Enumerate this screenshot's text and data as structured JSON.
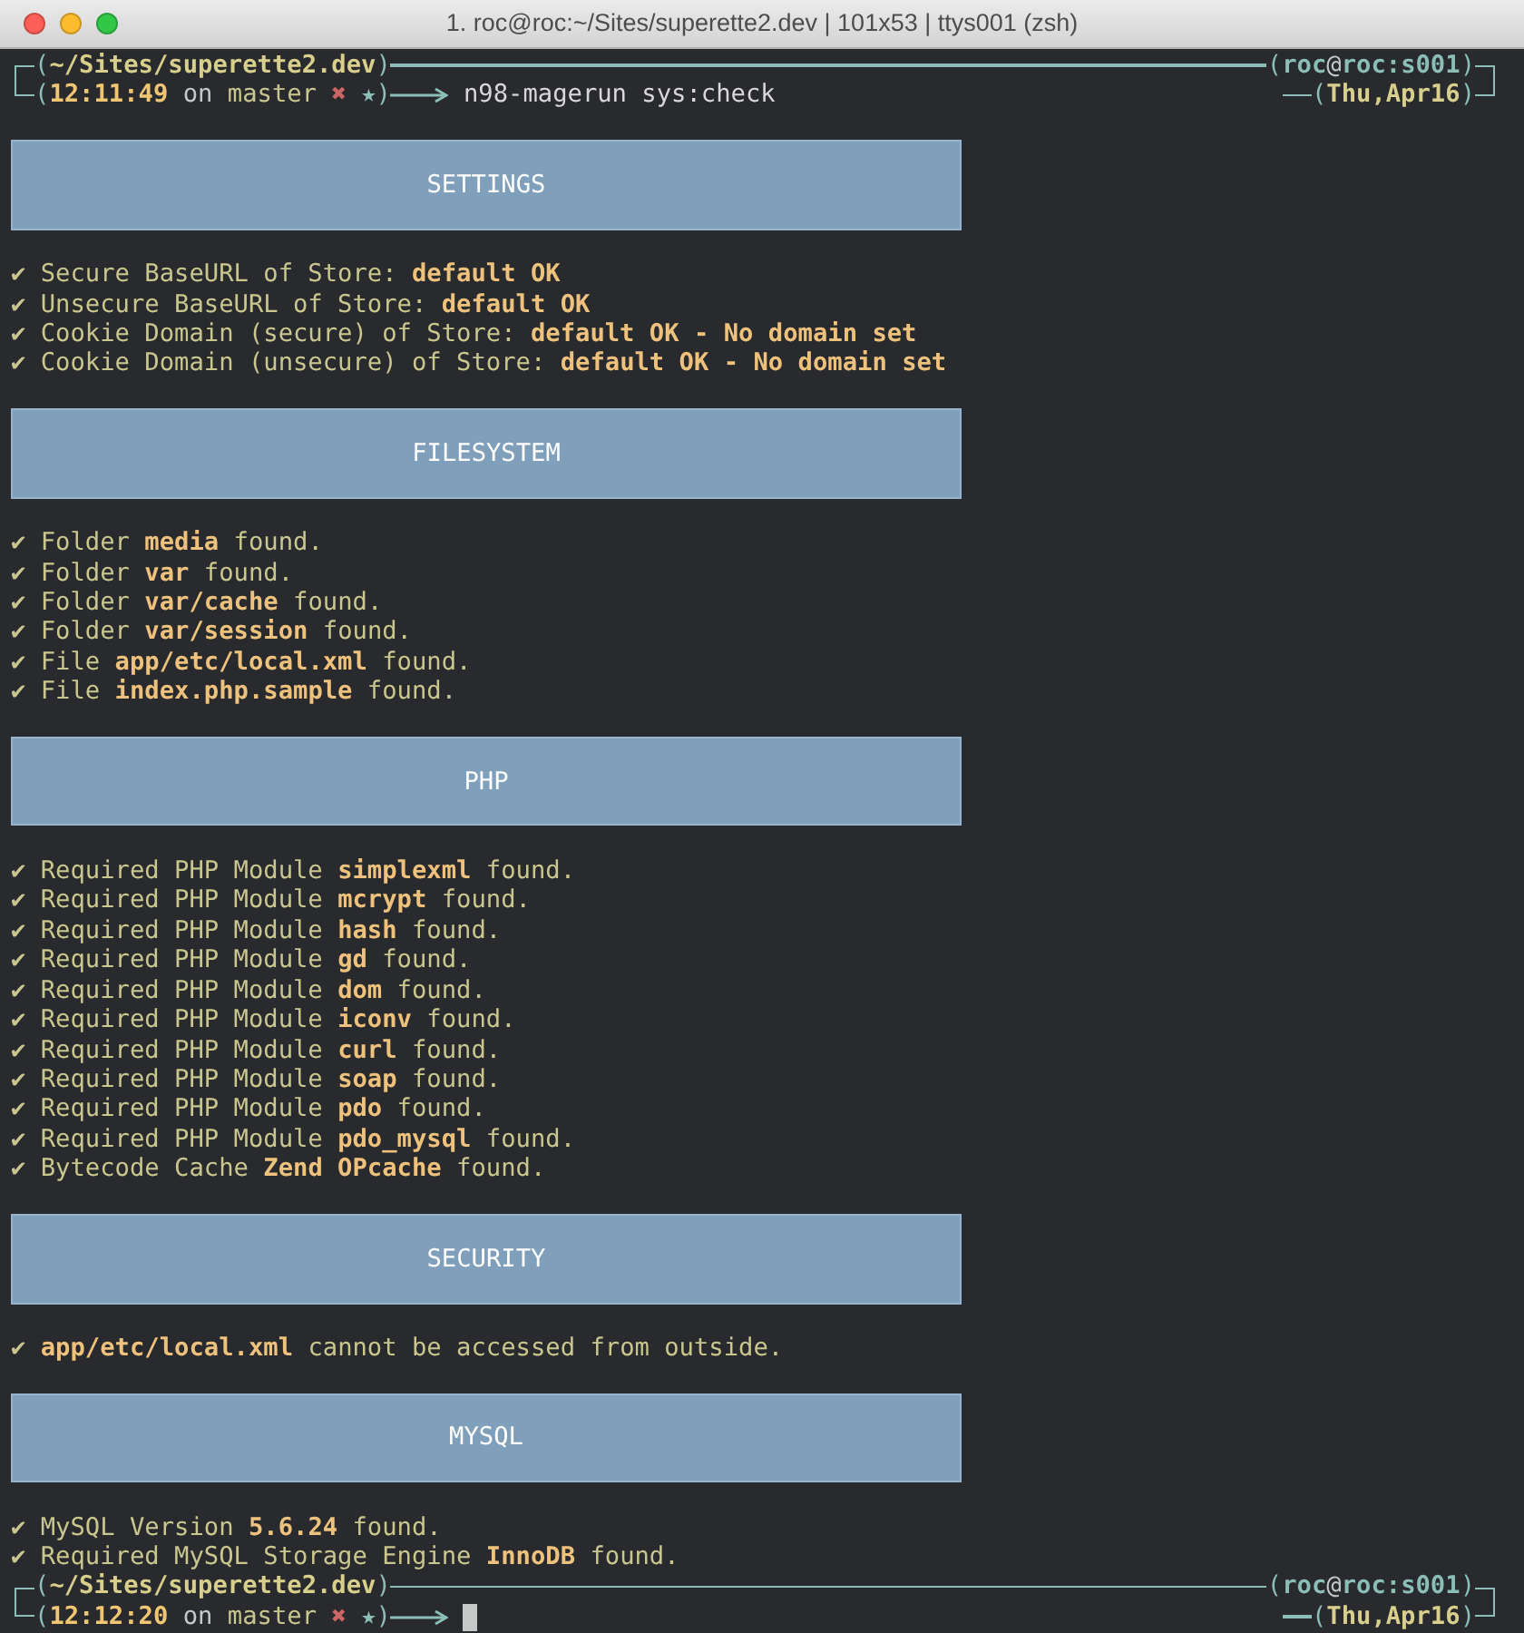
{
  "window": {
    "title": "1. roc@roc:~/Sites/superette2.dev | 101x53 | ttys001 (zsh)"
  },
  "first_prompt": {
    "line1_left": [
      {
        "kind": "paren",
        "text": "("
      },
      {
        "kind": "path",
        "text": "~/Sites/superette2.dev"
      },
      {
        "kind": "paren",
        "text": ")"
      }
    ],
    "line1_right": [
      {
        "kind": "paren",
        "text": "("
      },
      {
        "kind": "user",
        "text": "roc"
      },
      {
        "kind": "at",
        "text": "@"
      },
      {
        "kind": "user",
        "text": "roc:s001"
      },
      {
        "kind": "paren",
        "text": ")"
      }
    ],
    "line2_left": [
      {
        "kind": "paren",
        "text": "("
      },
      {
        "kind": "time",
        "text": "12:11:49"
      },
      {
        "kind": "plain",
        "text": " on "
      },
      {
        "kind": "branch",
        "text": "master"
      },
      {
        "kind": "dirty",
        "text": " ✖"
      },
      {
        "kind": "star",
        "text": " ★"
      },
      {
        "kind": "paren",
        "text": ")"
      }
    ],
    "command": "n98-magerun sys:check",
    "line2_right": [
      {
        "kind": "paren",
        "text": "("
      },
      {
        "kind": "date",
        "text": "Thu,Apr16"
      },
      {
        "kind": "paren",
        "text": ")"
      }
    ],
    "cursor": false
  },
  "sections": [
    {
      "title": "SETTINGS",
      "lines": [
        "✔ Secure BaseURL of Store: **default OK**",
        "✔ Unsecure BaseURL of Store: **default OK**",
        "✔ Cookie Domain (secure) of Store: **default OK - No domain set**",
        "✔ Cookie Domain (unsecure) of Store: **default OK - No domain set**"
      ]
    },
    {
      "title": "FILESYSTEM",
      "lines": [
        "✔ Folder **media** found.",
        "✔ Folder **var** found.",
        "✔ Folder **var/cache** found.",
        "✔ Folder **var/session** found.",
        "✔ File **app/etc/local.xml** found.",
        "✔ File **index.php.sample** found."
      ]
    },
    {
      "title": "PHP",
      "lines": [
        "✔ Required PHP Module **simplexml** found.",
        "✔ Required PHP Module **mcrypt** found.",
        "✔ Required PHP Module **hash** found.",
        "✔ Required PHP Module **gd** found.",
        "✔ Required PHP Module **dom** found.",
        "✔ Required PHP Module **iconv** found.",
        "✔ Required PHP Module **curl** found.",
        "✔ Required PHP Module **soap** found.",
        "✔ Required PHP Module **pdo** found.",
        "✔ Required PHP Module **pdo_mysql** found.",
        "✔ Bytecode Cache **Zend OPcache** found."
      ]
    },
    {
      "title": "SECURITY",
      "lines": [
        "✔ **app/etc/local.xml** cannot be accessed from outside."
      ]
    },
    {
      "title": "MYSQL",
      "lines": [
        "✔ MySQL Version **5.6.24** found.",
        "✔ Required MySQL Storage Engine **InnoDB** found."
      ]
    }
  ],
  "final_prompt": {
    "line1_left": [
      {
        "kind": "paren",
        "text": "("
      },
      {
        "kind": "path",
        "text": "~/Sites/superette2.dev"
      },
      {
        "kind": "paren",
        "text": ")"
      }
    ],
    "line1_right": [
      {
        "kind": "paren",
        "text": "("
      },
      {
        "kind": "user",
        "text": "roc"
      },
      {
        "kind": "at",
        "text": "@"
      },
      {
        "kind": "user",
        "text": "roc:s001"
      },
      {
        "kind": "paren",
        "text": ")"
      }
    ],
    "line2_left": [
      {
        "kind": "paren",
        "text": "("
      },
      {
        "kind": "time",
        "text": "12:12:20"
      },
      {
        "kind": "plain",
        "text": " on "
      },
      {
        "kind": "branch",
        "text": "master"
      },
      {
        "kind": "dirty",
        "text": " ✖"
      },
      {
        "kind": "star",
        "text": " ★"
      },
      {
        "kind": "paren",
        "text": ")"
      }
    ],
    "line2_right": [
      {
        "kind": "paren",
        "text": "("
      },
      {
        "kind": "date",
        "text": "Thu,Apr16"
      },
      {
        "kind": "paren",
        "text": ")"
      }
    ],
    "cursor": true
  }
}
